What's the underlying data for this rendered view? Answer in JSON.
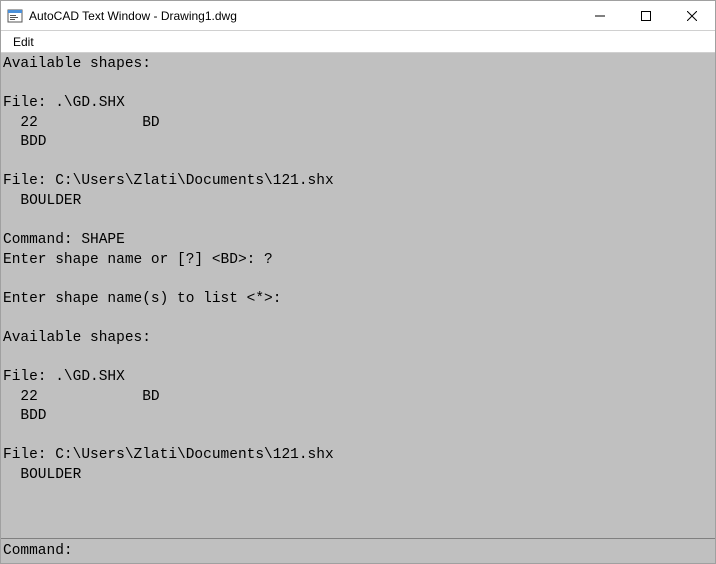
{
  "window": {
    "title": "AutoCAD Text Window - Drawing1.dwg"
  },
  "menubar": {
    "edit": "Edit"
  },
  "terminal": {
    "lines": [
      "Available shapes:",
      "",
      "File: .\\GD.SHX",
      "  22            BD",
      "  BDD",
      "",
      "File: C:\\Users\\Zlati\\Documents\\121.shx",
      "  BOULDER",
      "",
      "Command: SHAPE",
      "Enter shape name or [?] <BD>: ?",
      "",
      "Enter shape name(s) to list <*>:",
      "",
      "Available shapes:",
      "",
      "File: .\\GD.SHX",
      "  22            BD",
      "  BDD",
      "",
      "File: C:\\Users\\Zlati\\Documents\\121.shx",
      "  BOULDER",
      ""
    ]
  },
  "command_line": {
    "prompt": "Command: ",
    "value": ""
  }
}
